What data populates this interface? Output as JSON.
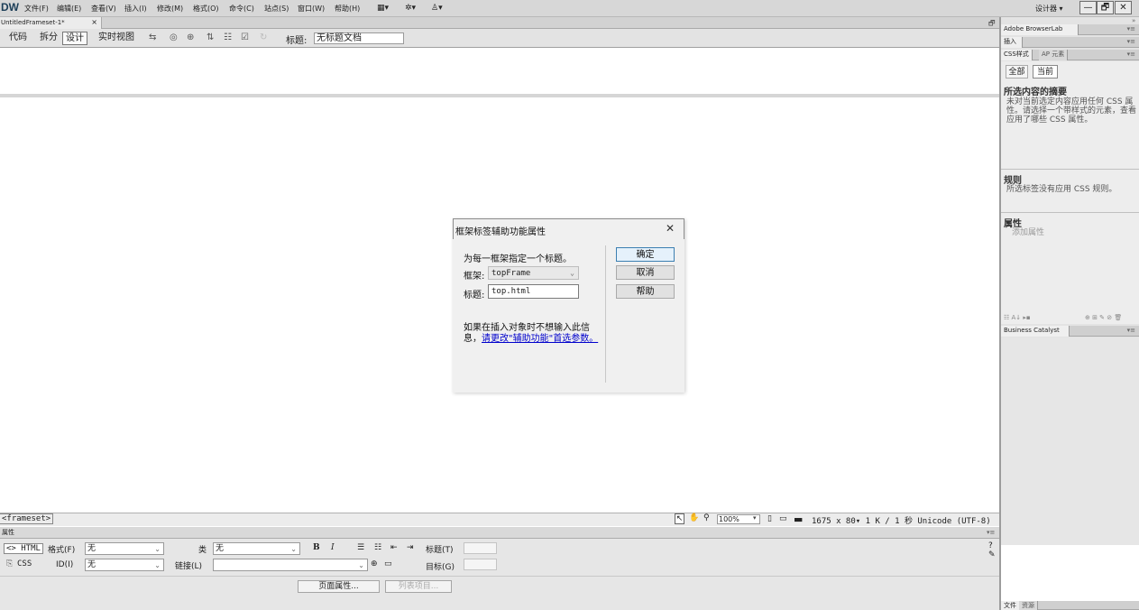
{
  "menubar": {
    "logo": "DW",
    "items": [
      "文件(F)",
      "编辑(E)",
      "查看(V)",
      "插入(I)",
      "修改(M)",
      "格式(O)",
      "命令(C)",
      "站点(S)",
      "窗口(W)",
      "帮助(H)"
    ],
    "workspace": "设计器 ▾",
    "window_buttons": [
      "—",
      "🗗",
      "✕"
    ]
  },
  "tab": {
    "name": "UntitledFrameset-1*",
    "close": "×"
  },
  "toolbar": {
    "view_buttons": [
      "代码",
      "拆分",
      "设计",
      "实时视图"
    ],
    "active_view": "设计",
    "title_label": "标题:",
    "title_value": "无标题文档"
  },
  "statusbar": {
    "tag": "<frameset>",
    "zoom": "100%",
    "dimensions": "1675 x 80▾  1 K / 1 秒 Unicode (UTF-8)"
  },
  "properties": {
    "panel_title": "属性",
    "html_tab": "<> HTML",
    "css_tab": "CSS",
    "format_label": "格式(F)",
    "format_value": "无",
    "id_label": "ID(I)",
    "id_value": "无",
    "class_label": "类",
    "class_value": "无",
    "link_label": "链接(L)",
    "link_value": "",
    "title_label": "标题(T)",
    "target_label": "目标(G)",
    "bold": "B",
    "italic": "I",
    "page_props_button": "页面属性...",
    "list_item_button": "列表项目..."
  },
  "right_panel": {
    "browserlab": "Adobe BrowserLab",
    "insert": "插入",
    "css_tab": "CSS样式",
    "ap_tab": "AP 元素",
    "all_button": "全部",
    "current_button": "当前",
    "summary_title": "所选内容的摘要",
    "summary_text": "未对当前选定内容应用任何 CSS 属性。请选择一个带样式的元素，查看应用了哪些 CSS 属性。",
    "rules_title": "规则",
    "rules_text": "所选标签没有应用 CSS 规则。",
    "props_title": "属性",
    "add_prop": "添加属性",
    "business_catalyst": "Business Catalyst",
    "files_tab": "文件",
    "assets_tab": "资源"
  },
  "dialog": {
    "title": "框架标签辅助功能属性",
    "close": "✕",
    "instruction": "为每一框架指定一个标题。",
    "frame_label": "框架:",
    "frame_value": "topFrame",
    "title_label": "标题:",
    "title_value": "top.html",
    "ok_button": "确定",
    "cancel_button": "取消",
    "help_button": "帮助",
    "note_text": "如果在插入对象时不想输入此信息，",
    "note_link": "请更改\"辅助功能\"首选参数。"
  }
}
